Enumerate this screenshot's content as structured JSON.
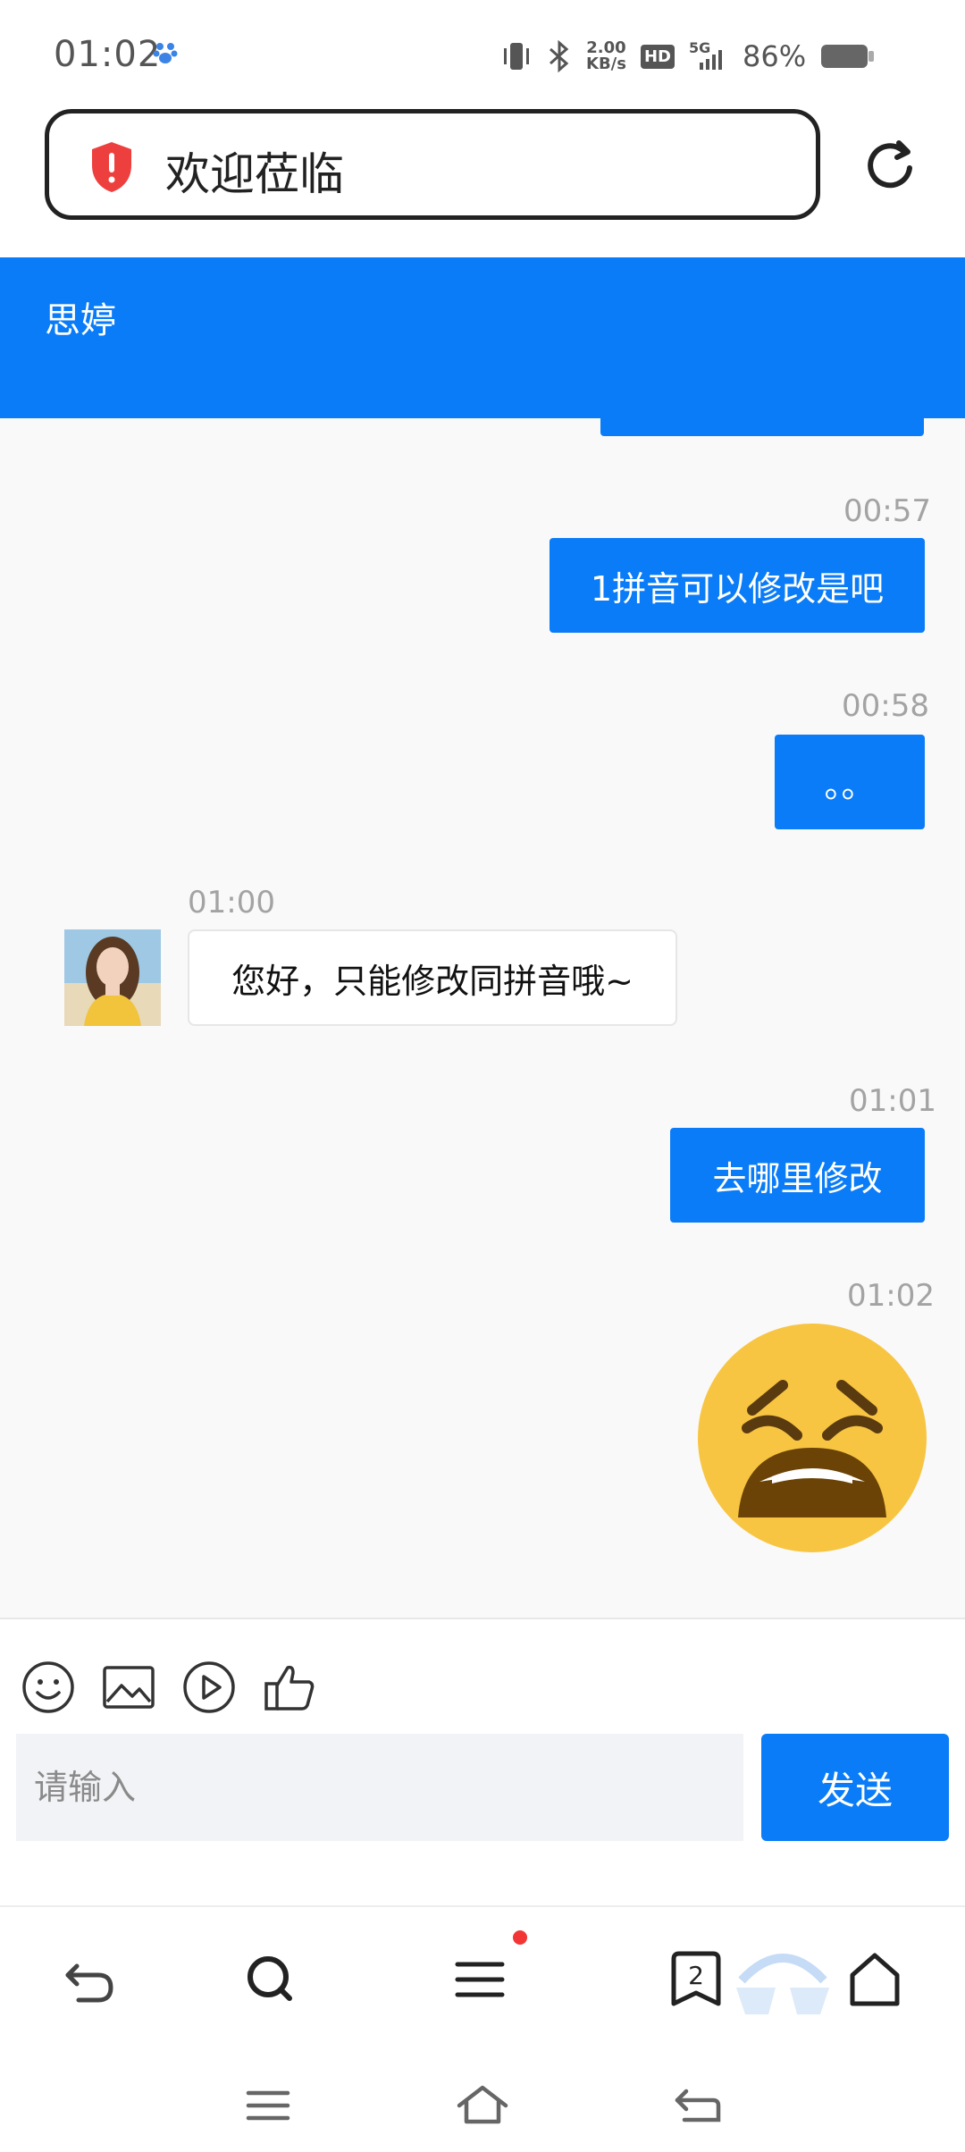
{
  "status_bar": {
    "time": "01:02",
    "speed_value": "2.00",
    "speed_unit": "KB/s",
    "hd_label": "HD",
    "network": "5G",
    "battery": "86%"
  },
  "address_bar": {
    "title": "欢迎莅临"
  },
  "chat_header": {
    "name": "思婷"
  },
  "messages": [
    {
      "time": "00:57",
      "text": "1拼音可以修改是吧"
    },
    {
      "time": "00:58",
      "text": "。。"
    },
    {
      "time": "01:00",
      "text": "您好，只能修改同拼音哦~"
    },
    {
      "time": "01:01",
      "text": "去哪里修改"
    },
    {
      "time": "01:02",
      "text": ""
    }
  ],
  "composer": {
    "placeholder": "请输入",
    "send_label": "发送",
    "tools": [
      "emoji-icon",
      "image-icon",
      "video-icon",
      "thumbs-up-icon"
    ]
  },
  "browser_nav": {
    "tab_count": "2",
    "icons": [
      "back-icon",
      "search-icon",
      "menu-icon",
      "tabs-icon",
      "home-icon"
    ]
  },
  "system_nav": {
    "icons": [
      "recents-icon",
      "home-icon",
      "back-icon"
    ]
  },
  "colors": {
    "accent": "#0a7cf7",
    "chat_background": "#f9f9f9",
    "timestamp": "#a3a3a3",
    "notification_dot": "#f23535",
    "emoji_face": "#f7c542"
  }
}
